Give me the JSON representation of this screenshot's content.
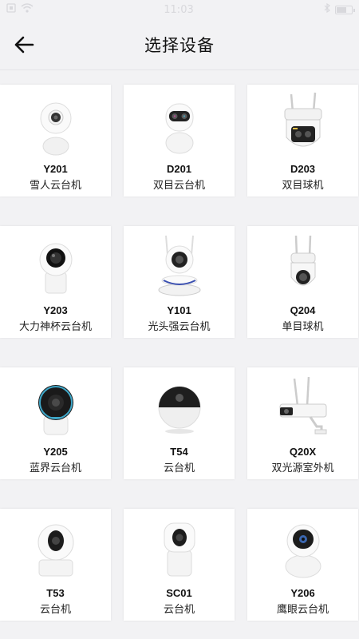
{
  "status_bar": {
    "time": "11:03"
  },
  "header": {
    "title": "选择设备"
  },
  "devices": [
    {
      "model": "Y201",
      "name": "雪人云台机",
      "icon": "snowman-ptz-camera-icon"
    },
    {
      "model": "D201",
      "name": "双目云台机",
      "icon": "dual-lens-ptz-camera-icon"
    },
    {
      "model": "D203",
      "name": "双目球机",
      "icon": "dual-lens-dome-camera-icon"
    },
    {
      "model": "Y203",
      "name": "大力神杯云台机",
      "icon": "trophy-ptz-camera-icon"
    },
    {
      "model": "Y101",
      "name": "光头强云台机",
      "icon": "bald-ptz-camera-icon"
    },
    {
      "model": "Q204",
      "name": "单目球机",
      "icon": "single-lens-dome-camera-icon"
    },
    {
      "model": "Y205",
      "name": "蓝界云台机",
      "icon": "blue-ring-ptz-camera-icon"
    },
    {
      "model": "T54",
      "name": "云台机",
      "icon": "sphere-ptz-camera-icon"
    },
    {
      "model": "Q20X",
      "name": "双光源室外机",
      "icon": "outdoor-bullet-camera-icon"
    },
    {
      "model": "T53",
      "name": "云台机",
      "icon": "ptz-camera-icon"
    },
    {
      "model": "SC01",
      "name": "云台机",
      "icon": "cube-ptz-camera-icon"
    },
    {
      "model": "Y206",
      "name": "鹰眼云台机",
      "icon": "eagle-eye-ptz-camera-icon"
    }
  ]
}
